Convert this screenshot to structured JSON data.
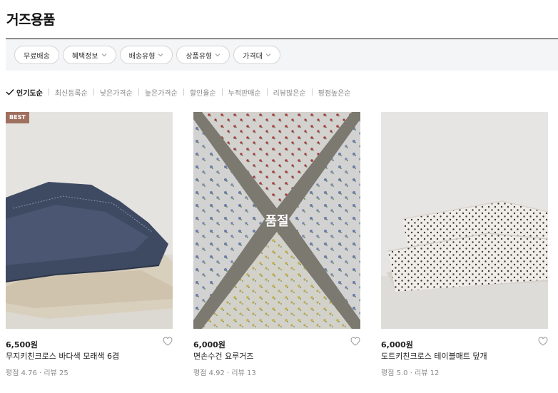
{
  "page": {
    "title": "거즈용품"
  },
  "filters": [
    {
      "label": "무료배송",
      "has_dropdown": false
    },
    {
      "label": "혜택정보",
      "has_dropdown": true
    },
    {
      "label": "배송유형",
      "has_dropdown": true
    },
    {
      "label": "상품유형",
      "has_dropdown": true
    },
    {
      "label": "가격대",
      "has_dropdown": true
    }
  ],
  "sort": {
    "active_index": 0,
    "options": [
      "인기도순",
      "최신등록순",
      "낮은가격순",
      "높은가격순",
      "할인율순",
      "누적판매순",
      "리뷰많은순",
      "평점높은순"
    ]
  },
  "products": [
    {
      "badge": "BEST",
      "soldout_label": "",
      "price": "6,500원",
      "name": "무지키친크로스 바다색 모래색 6겹",
      "rating_label": "평점",
      "rating": "4.76",
      "review_label": "리뷰",
      "reviews": "25"
    },
    {
      "badge": "",
      "soldout_label": "품절",
      "price": "6,000원",
      "name": "면손수건 요루거즈",
      "rating_label": "평점",
      "rating": "4.92",
      "review_label": "리뷰",
      "reviews": "13"
    },
    {
      "badge": "",
      "soldout_label": "",
      "price": "6,000원",
      "name": "도트키친크로스 테이블매트 덮개",
      "rating_label": "평점",
      "rating": "5.0",
      "review_label": "리뷰",
      "reviews": "12"
    }
  ],
  "colors": {
    "badge_bg": "#a0705e",
    "filter_bar_bg": "#f4f5f6",
    "rule": "#111111"
  }
}
